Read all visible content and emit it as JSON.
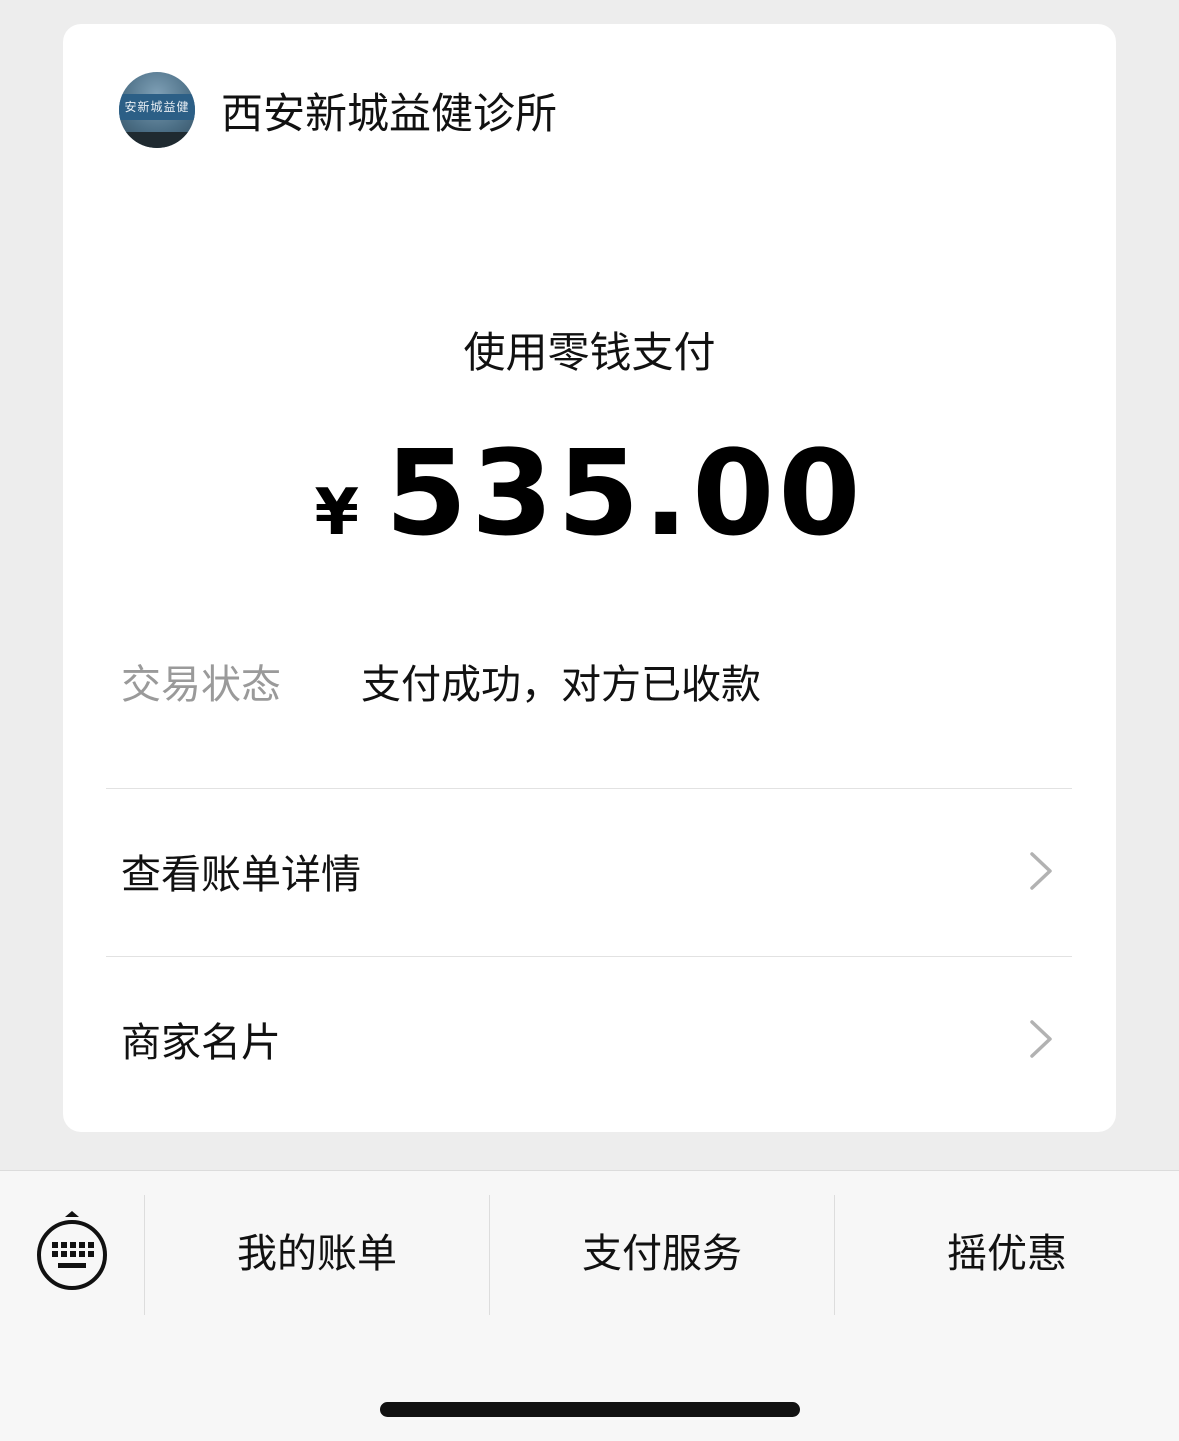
{
  "merchant": {
    "avatar_sign_text": "安新城益健",
    "name": "西安新城益健诊所"
  },
  "payment": {
    "method": "使用零钱支付",
    "currency_symbol": "¥",
    "amount": "535.00"
  },
  "status": {
    "label": "交易状态",
    "value": "支付成功，对方已收款"
  },
  "links": [
    {
      "label": "查看账单详情",
      "icon": "chevron-right-icon"
    },
    {
      "label": "商家名片",
      "icon": "chevron-right-icon"
    }
  ],
  "bottom_menu": {
    "keyboard_icon": "keyboard-icon",
    "items": [
      {
        "label": "我的账单"
      },
      {
        "label": "支付服务"
      },
      {
        "label": "摇优惠"
      }
    ]
  },
  "colors": {
    "background": "#ededed",
    "card": "#ffffff",
    "muted_text": "#9a9a9a",
    "bottom_bar": "#f7f7f7"
  }
}
